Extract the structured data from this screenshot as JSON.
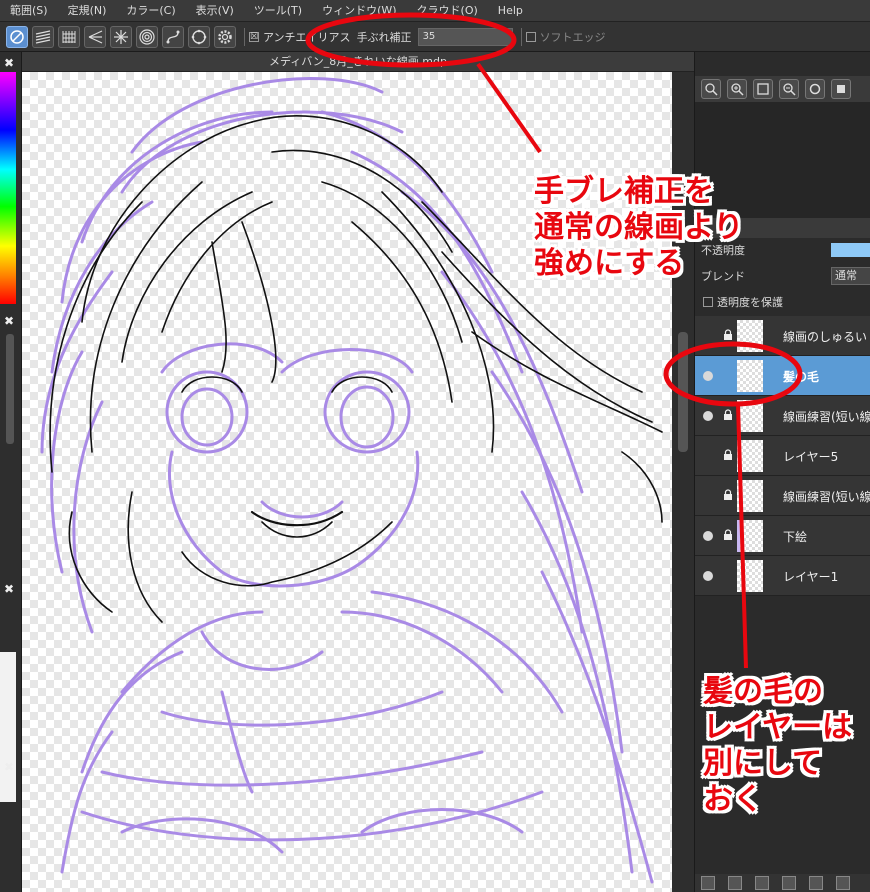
{
  "menubar": {
    "items": [
      "範囲(S)",
      "定規(N)",
      "カラー(C)",
      "表示(V)",
      "ツール(T)",
      "ウィンドウ(W)",
      "クラウド(O)",
      "Help"
    ]
  },
  "toolbar": {
    "tools": [
      "no-snap",
      "parallel-snap",
      "grid-snap",
      "radial-snap",
      "radial-center-snap",
      "concentric-snap",
      "curve-snap",
      "ellipse-snap",
      "snap-settings"
    ],
    "antialias_label": "アンチエイリアス",
    "antialias_checked": "☒",
    "stabilizer_label": "手ぶれ補正",
    "stabilizer_value": "35",
    "soft_edge_label": "ソフトエッジ"
  },
  "document": {
    "tab_title": "メディバン_8月_きれいな線画.mdp"
  },
  "left_panel": {
    "close_glyph": "✖"
  },
  "right_panel": {
    "opacity_label": "不透明度",
    "blend_label": "ブレンド",
    "blend_value": "通常",
    "protect_alpha_label": "透明度を保護",
    "layers": [
      {
        "name": "線画のしゅるい",
        "visible": false,
        "locked": true,
        "selected": false
      },
      {
        "name": "髪の毛",
        "visible": true,
        "locked": false,
        "selected": true
      },
      {
        "name": "線画練習(短い線",
        "visible": true,
        "locked": true,
        "selected": false
      },
      {
        "name": "レイヤー5",
        "visible": false,
        "locked": true,
        "selected": false
      },
      {
        "name": "線画練習(短い線",
        "visible": false,
        "locked": true,
        "selected": false
      },
      {
        "name": "下絵",
        "visible": true,
        "locked": true,
        "selected": false
      },
      {
        "name": "レイヤー1",
        "visible": true,
        "locked": false,
        "selected": false
      }
    ]
  },
  "annotations": {
    "note_1": [
      "手ブレ補正を",
      "通常の線画より",
      "強めにする"
    ],
    "note_2": [
      "髪の毛の",
      "レイヤーは",
      "別にして",
      "おく"
    ],
    "color": "#e8070f"
  },
  "colors": {
    "sketch": "#a98ae6",
    "lineart": "#111111",
    "selected_layer": "#5b9bd5",
    "opacity_bar": "#8ec9f6"
  }
}
